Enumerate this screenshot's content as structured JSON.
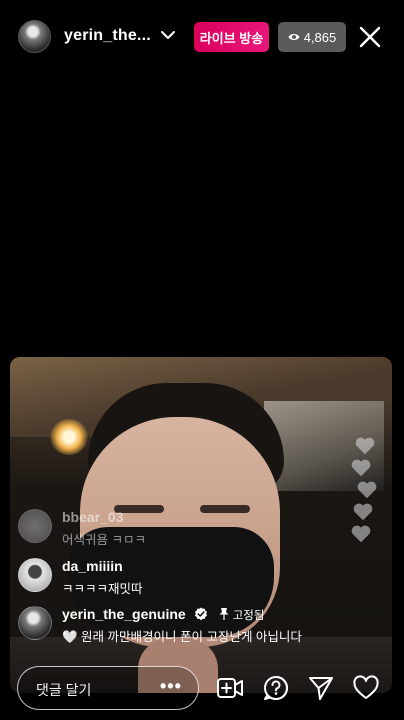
{
  "header": {
    "username": "yerin_the...",
    "live_label": "라이브 방송",
    "viewer_count": "4,865"
  },
  "comments": [
    {
      "username": "bbear_03",
      "text": "어색귀욤 ㅋㅁㅋ"
    },
    {
      "username": "da_miiiin",
      "text": "ㅋㅋㅋㅋ재밋따"
    },
    {
      "username": "yerin_the_genuine",
      "pinned_label": "고정됨",
      "text": "🤍 원래 까만배경이니 폰이 고장난게 아닙니다"
    }
  ],
  "composer": {
    "placeholder": "댓글 달기",
    "more_label": "•••"
  },
  "icons": {
    "header": [
      "chevron-down-icon",
      "eye-icon",
      "close-icon"
    ],
    "bottom": [
      "add-video-guest-icon",
      "question-icon",
      "share-send-icon",
      "like-heart-icon"
    ],
    "comments": [
      "verified-badge-icon",
      "pin-icon"
    ]
  },
  "colors": {
    "live_badge": "#e8177c",
    "viewer_badge": "#5a5a5a",
    "background": "#000000"
  }
}
